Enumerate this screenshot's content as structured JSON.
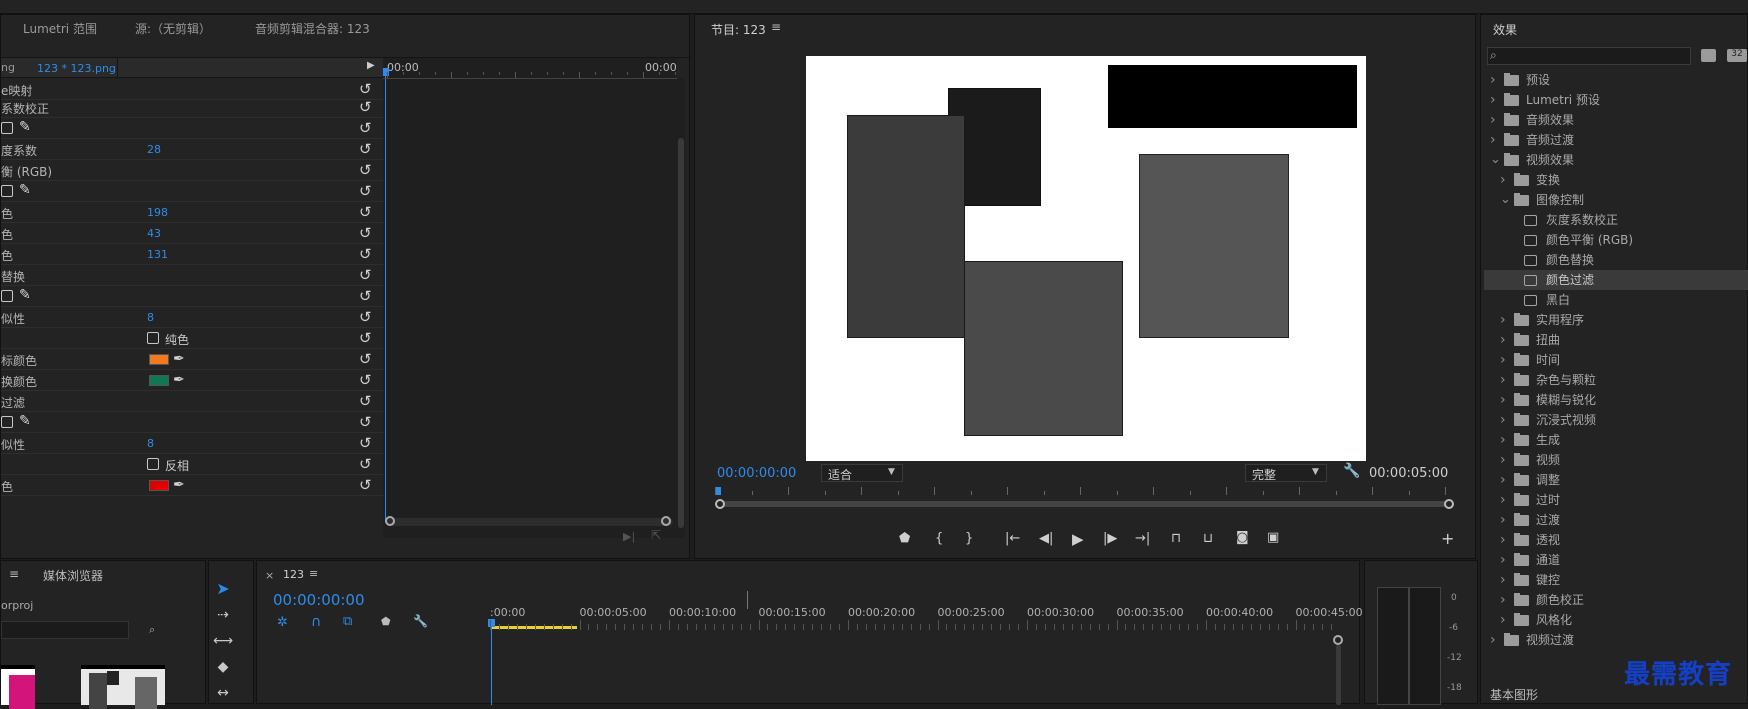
{
  "window": {
    "top_bar": ""
  },
  "left_panel": {
    "tabs": [
      {
        "label": "Lumetri 范围"
      },
      {
        "label": "源:（无剪辑）"
      },
      {
        "label": "音频剪辑混合器: 123"
      }
    ],
    "clip_label": "123 * 123.png",
    "clip_prefix": "ng",
    "timecode_start": "00:00",
    "timecode_end": "00:00",
    "rows": [
      {
        "label": "e映射",
        "value": ""
      },
      {
        "label": "系数校正",
        "value": ""
      },
      {
        "label": "",
        "value": ""
      },
      {
        "label": "度系数",
        "value": "28"
      },
      {
        "label": "衡 (RGB)",
        "value": ""
      },
      {
        "label": "",
        "value": ""
      },
      {
        "label": "色",
        "value": "198"
      },
      {
        "label": "色",
        "value": "43"
      },
      {
        "label": "色",
        "value": "131"
      },
      {
        "label": "替换",
        "value": ""
      },
      {
        "label": "",
        "value": ""
      },
      {
        "label": "似性",
        "value": "8"
      },
      {
        "label": "",
        "value": "",
        "check": "纯色"
      },
      {
        "label": "标颜色",
        "value": "",
        "color": "#f07a1f"
      },
      {
        "label": "换颜色",
        "value": "",
        "color": "#117752"
      },
      {
        "label": "过滤",
        "value": ""
      },
      {
        "label": "",
        "value": ""
      },
      {
        "label": "似性",
        "value": "8"
      },
      {
        "label": "",
        "value": "",
        "check": "反相"
      },
      {
        "label": "色",
        "value": "",
        "color": "#e00000"
      }
    ]
  },
  "program_monitor": {
    "title": "节目: 123",
    "menu_icon": "≡",
    "timecode_current": "00:00:00:00",
    "fit_select": "适合",
    "quality_select": "完整",
    "timecode_duration": "00:00:05:00"
  },
  "effects_panel": {
    "title": "效果",
    "search_placeholder": "",
    "icon_badges": [
      "32"
    ],
    "items": [
      {
        "label": "预设",
        "level": 0,
        "kind": "folder",
        "expanded": false
      },
      {
        "label": "Lumetri 预设",
        "level": 0,
        "kind": "folder",
        "expanded": false
      },
      {
        "label": "音频效果",
        "level": 0,
        "kind": "folder",
        "expanded": false
      },
      {
        "label": "音频过渡",
        "level": 0,
        "kind": "folder",
        "expanded": false
      },
      {
        "label": "视频效果",
        "level": 0,
        "kind": "folder",
        "expanded": true
      },
      {
        "label": "变换",
        "level": 1,
        "kind": "folder",
        "expanded": false
      },
      {
        "label": "图像控制",
        "level": 1,
        "kind": "folder",
        "expanded": true
      },
      {
        "label": "灰度系数校正",
        "level": 2,
        "kind": "effect"
      },
      {
        "label": "颜色平衡 (RGB)",
        "level": 2,
        "kind": "effect"
      },
      {
        "label": "颜色替换",
        "level": 2,
        "kind": "effect"
      },
      {
        "label": "颜色过滤",
        "level": 2,
        "kind": "effect",
        "selected": true
      },
      {
        "label": "黑白",
        "level": 2,
        "kind": "effect"
      },
      {
        "label": "实用程序",
        "level": 1,
        "kind": "folder",
        "expanded": false
      },
      {
        "label": "扭曲",
        "level": 1,
        "kind": "folder",
        "expanded": false
      },
      {
        "label": "时间",
        "level": 1,
        "kind": "folder",
        "expanded": false
      },
      {
        "label": "杂色与颗粒",
        "level": 1,
        "kind": "folder",
        "expanded": false
      },
      {
        "label": "模糊与锐化",
        "level": 1,
        "kind": "folder",
        "expanded": false
      },
      {
        "label": "沉浸式视频",
        "level": 1,
        "kind": "folder",
        "expanded": false
      },
      {
        "label": "生成",
        "level": 1,
        "kind": "folder",
        "expanded": false
      },
      {
        "label": "视频",
        "level": 1,
        "kind": "folder",
        "expanded": false
      },
      {
        "label": "调整",
        "level": 1,
        "kind": "folder",
        "expanded": false
      },
      {
        "label": "过时",
        "level": 1,
        "kind": "folder",
        "expanded": false
      },
      {
        "label": "过渡",
        "level": 1,
        "kind": "folder",
        "expanded": false
      },
      {
        "label": "透视",
        "level": 1,
        "kind": "folder",
        "expanded": false
      },
      {
        "label": "通道",
        "level": 1,
        "kind": "folder",
        "expanded": false
      },
      {
        "label": "键控",
        "level": 1,
        "kind": "folder",
        "expanded": false
      },
      {
        "label": "颜色校正",
        "level": 1,
        "kind": "folder",
        "expanded": false
      },
      {
        "label": "风格化",
        "level": 1,
        "kind": "folder",
        "expanded": false
      },
      {
        "label": "视频过渡",
        "level": 0,
        "kind": "folder",
        "expanded": false
      }
    ],
    "footer": "基本图形",
    "watermark": "最需教育"
  },
  "project_panel": {
    "menu_icon": "≡",
    "tab": "媒体浏览器",
    "project_name": "orproj"
  },
  "timeline": {
    "close": "×",
    "sequence": "123",
    "menu_icon": "≡",
    "timecode": "00:00:00:00",
    "ruler_labels": [
      ":00:00",
      "00:00:05:00",
      "00:00:10:00",
      "00:00:15:00",
      "00:00:20:00",
      "00:00:25:00",
      "00:00:30:00",
      "00:00:35:00",
      "00:00:40:00",
      "00:00:45:00"
    ]
  },
  "audio_meter": {
    "scale": [
      "0",
      "-6",
      "-12",
      "-18"
    ]
  },
  "colors": {
    "accent": "#2d8ceb",
    "highlight_row": "#3a3a3a",
    "timeline_yellow": "#e8d12c"
  }
}
